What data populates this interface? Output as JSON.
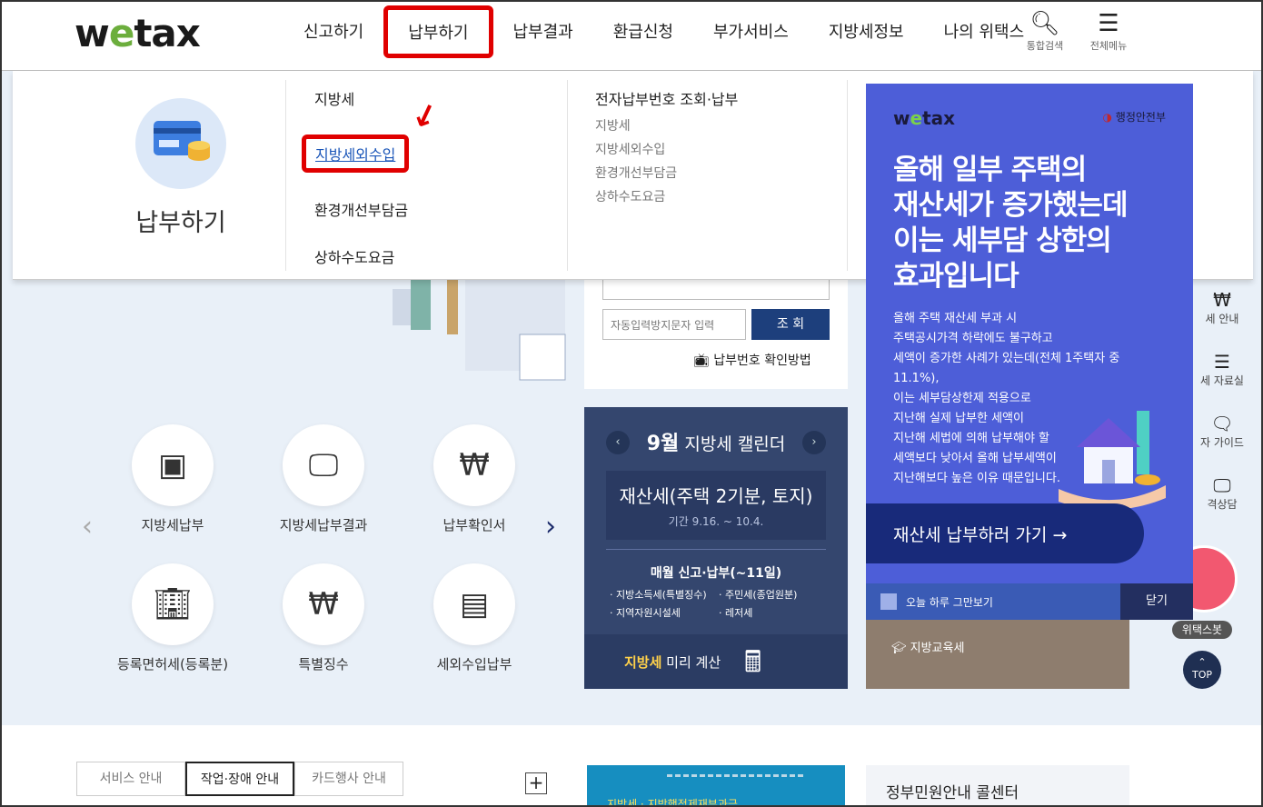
{
  "header": {
    "logo_pre": "w",
    "logo_e": "e",
    "logo_post": "tax",
    "nav": [
      "신고하기",
      "납부하기",
      "납부결과",
      "환급신청",
      "부가서비스",
      "지방세정보",
      "나의 위택스"
    ],
    "search_label": "통합검색",
    "menu_label": "전체메뉴"
  },
  "mega": {
    "title": "납부하기",
    "col1": [
      "지방세",
      "지방세외수입",
      "환경개선부담금",
      "상하수도요금"
    ],
    "col2_title": "전자납부번호 조회·납부",
    "col2": [
      "지방세",
      "지방세외수입",
      "환경개선부담금",
      "상하수도요금"
    ]
  },
  "quick": [
    {
      "label": "지방세납부",
      "icon": "card-reader-icon"
    },
    {
      "label": "지방세납부결과",
      "icon": "monitor-folder-icon"
    },
    {
      "label": "납부확인서",
      "icon": "receipt-hand-icon"
    },
    {
      "label": "등록면허세(등록분)",
      "icon": "building-won-icon"
    },
    {
      "label": "특별징수",
      "icon": "money-bag-icon"
    },
    {
      "label": "세외수입납부",
      "icon": "card-coins-icon"
    }
  ],
  "search": {
    "captcha_placeholder": "자동입력방지문자 입력",
    "submit": "조 회",
    "how_link": "납부번호 확인방법"
  },
  "calendar": {
    "month": "9월",
    "title_suffix": " 지방세 캘린더",
    "tax_title": "재산세(주택 2기분, 토지)",
    "period": "기간 9.16. ~ 10.4.",
    "monthly_title": "매월 신고·납부(~11일)",
    "monthly_items": [
      "· 지방소득세(특별징수)",
      "· 주민세(종업원분)",
      "· 지역자원시설세",
      "· 레저세"
    ],
    "footer_highlight": "지방세",
    "footer_text": " 미리 계산"
  },
  "popup": {
    "logo_pre": "w",
    "logo_e": "e",
    "logo_post": "tax",
    "ministry": "행정안전부",
    "headline": [
      "올해 일부 주택의",
      "재산세가 증가했는데",
      "이는 세부담 상한의",
      "효과입니다"
    ],
    "body": [
      "올해 주택 재산세 부과 시",
      "주택공시가격 하락에도 불구하고",
      "세액이 증가한 사례가 있는데(전체 1주택자 중 11.1%),",
      "이는 세부담상한제 적용으로",
      "지난해 실제 납부한 세액이",
      "지난해 세법에 의해 납부해야 할",
      "세액보다 낮아서 올해 납부세액이",
      "지난해보다 높은 이유 때문입니다."
    ],
    "cta": "재산세 납부하러 가기",
    "today_label": "오늘 하루 그만보기",
    "close_label": "닫기"
  },
  "edu_tab": "지방교육세",
  "rail": [
    "세 안내",
    "세 자료실",
    "자 가이드",
    "격상담"
  ],
  "bot_label": "위택스봇",
  "top_label": "TOP",
  "lower": {
    "tabs": [
      "서비스 안내",
      "작업·장애 안내",
      "카드행사 안내"
    ],
    "banner_title": "지방세 · 지방행정제재부과금",
    "gov_title": "정부민원안내 콜센터"
  },
  "colors": {
    "accent_red": "#e00000",
    "navy": "#1d3f7c",
    "popup_blue": "#4d5ed8"
  }
}
